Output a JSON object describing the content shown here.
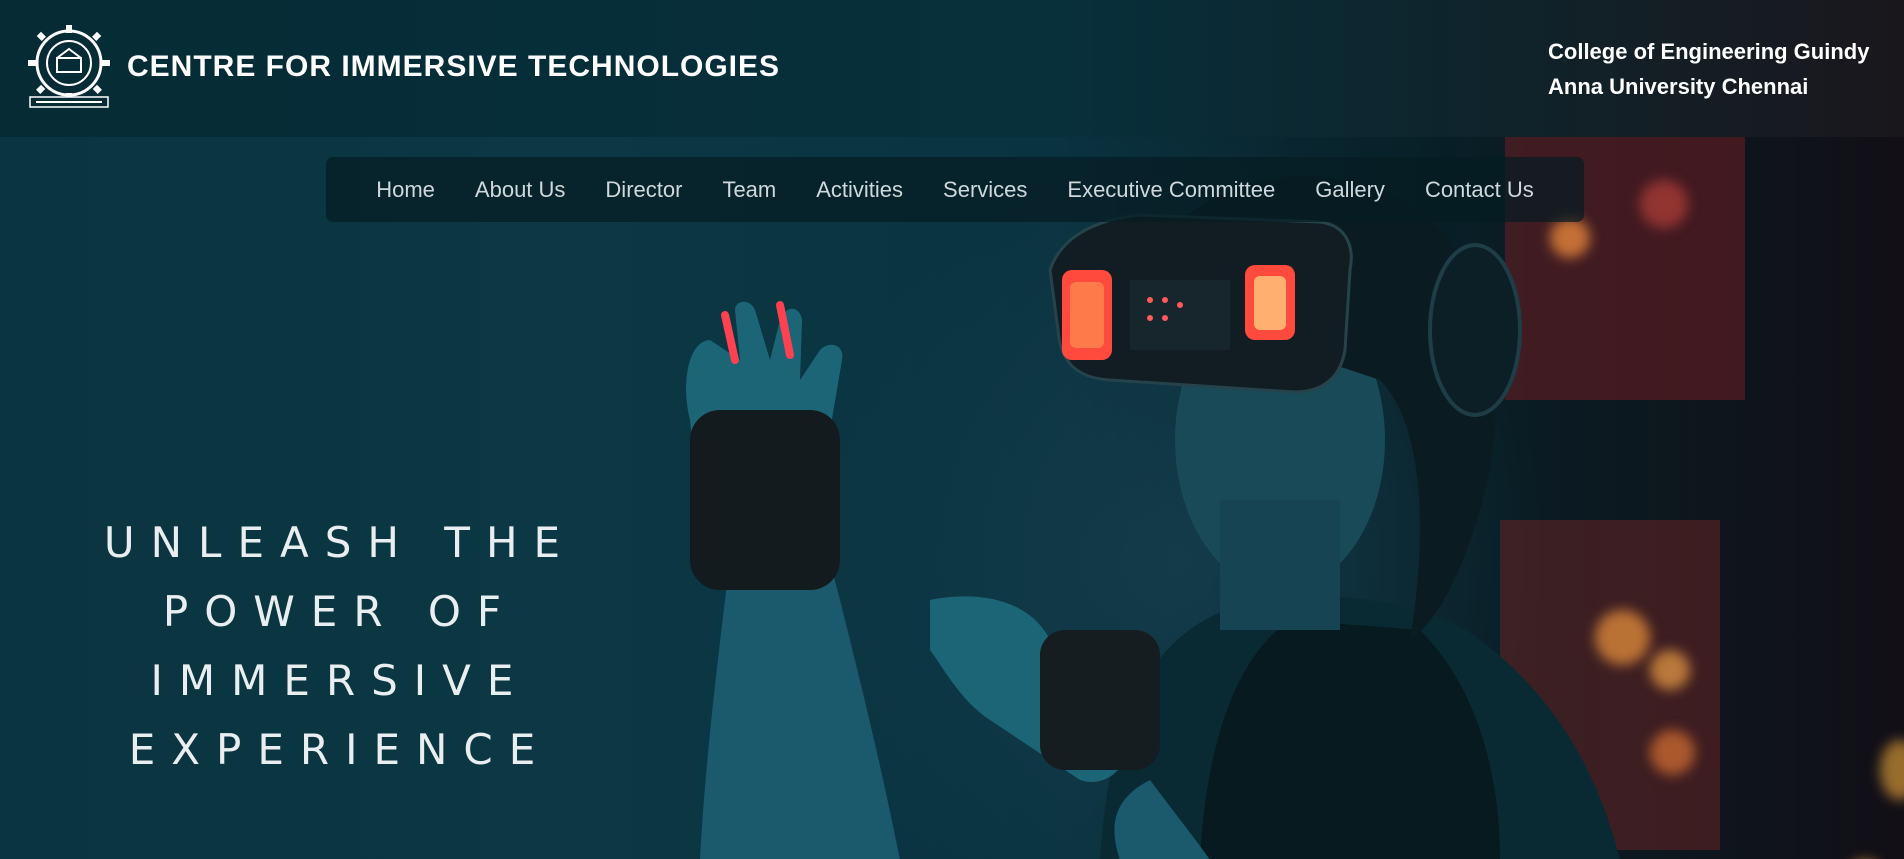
{
  "header": {
    "site_title": "CENTRE FOR IMMERSIVE TECHNOLOGIES",
    "affiliation_line1": "College of Engineering Guindy",
    "affiliation_line2": "Anna University Chennai",
    "logo_icon": "anna-university-seal-icon"
  },
  "nav": {
    "items": [
      {
        "label": "Home"
      },
      {
        "label": "About Us"
      },
      {
        "label": "Director"
      },
      {
        "label": "Team"
      },
      {
        "label": "Activities"
      },
      {
        "label": "Services"
      },
      {
        "label": "Executive Committee"
      },
      {
        "label": "Gallery"
      },
      {
        "label": "Contact Us"
      }
    ]
  },
  "hero": {
    "headline_lines": [
      "UNLEASH THE",
      "POWER OF",
      "IMMERSIVE",
      "EXPERIENCE"
    ],
    "image": "vr-headset-woman-photo"
  },
  "colors": {
    "header_bg": "#062b35",
    "hero_teal": "#0b3844",
    "nav_text": "#cfd9dc",
    "headline_text": "#e9eef0",
    "accent_red": "#ff3b3b"
  }
}
